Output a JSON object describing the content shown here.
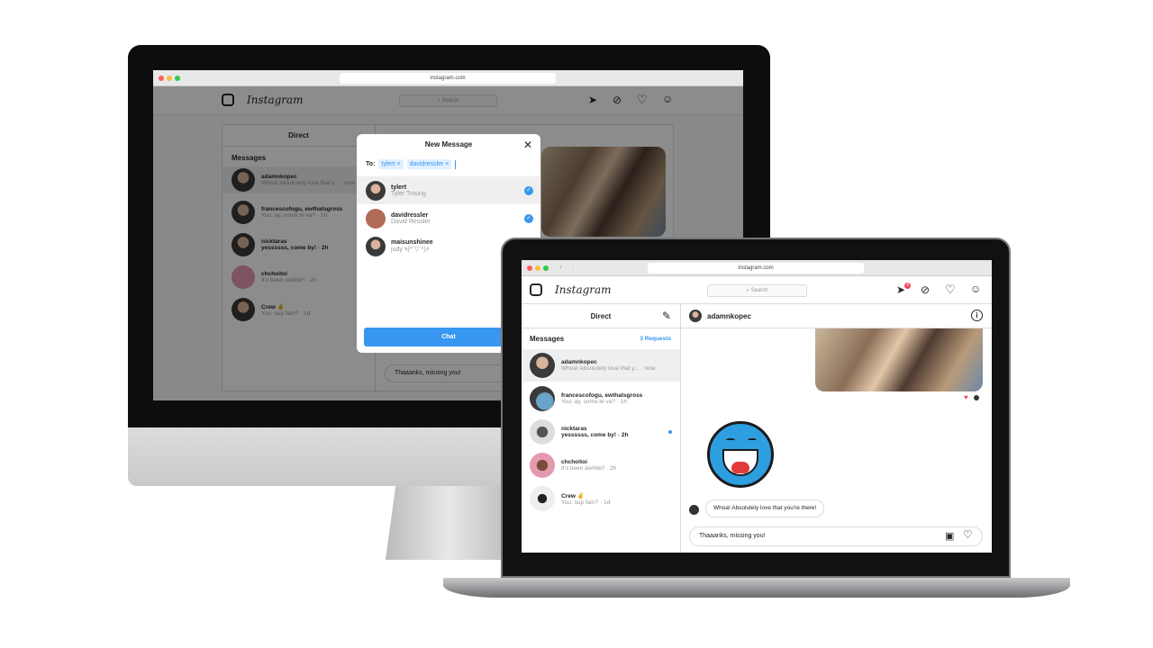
{
  "browser": {
    "url": "instagram.com"
  },
  "header": {
    "logo_text": "Instagram",
    "search_placeholder": "Search",
    "notif_badge": "4",
    "icons": [
      "direct-icon",
      "explore-icon",
      "heart-icon",
      "profile-icon"
    ]
  },
  "direct": {
    "title": "Direct",
    "messages_label": "Messages",
    "requests": "3 Requests",
    "threads": [
      {
        "name": "adamnkopec",
        "preview": "Whoa! Absolutely love that y... · now",
        "bold": false
      },
      {
        "name": "francescofogu, ewthatsgross",
        "preview": "You: ay, como te va? · 1h",
        "bold": false
      },
      {
        "name": "nicktaras",
        "preview": "yessssss, come by! · 2h",
        "bold": true
      },
      {
        "name": "chchoitoi",
        "preview": "It's been awhile!! · 2h",
        "bold": false
      },
      {
        "name": "Crew ✌",
        "preview": "You: sup fam? · 1d",
        "bold": false
      }
    ]
  },
  "chat": {
    "contact": "adamnkopec",
    "received": "Whoa! Absolutely love that you're there!",
    "input_value": "Thaaanks, missing you!"
  },
  "modal": {
    "title": "New Message",
    "to_label": "To:",
    "chips": [
      "tylert ×",
      "davidressler ×"
    ],
    "suggestions": [
      {
        "username": "tylert",
        "fullname": "Tyler Troung",
        "selected": true
      },
      {
        "username": "davidressler",
        "fullname": "David Ressler",
        "selected": true
      },
      {
        "username": "maisunshinee",
        "fullname": "judy ٩(*´▽`*)۶",
        "selected": false
      }
    ],
    "chat_button": "Chat"
  },
  "colors": {
    "accent": "#3897f0",
    "badge": "#ed4956",
    "requests": "#3897f0"
  }
}
